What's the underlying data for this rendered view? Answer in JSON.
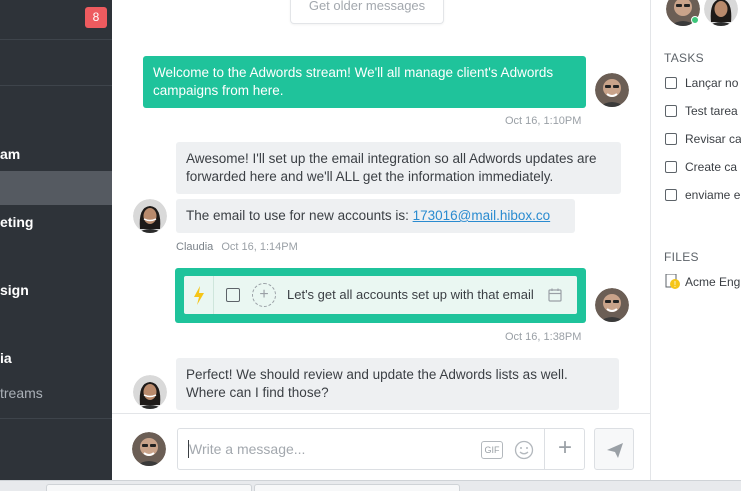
{
  "sidebar": {
    "badge": "8",
    "items": [
      {
        "label": "am"
      },
      {
        "label": ""
      },
      {
        "label": "eting"
      },
      {
        "label": "sign"
      },
      {
        "label": "ia"
      }
    ],
    "sub_label": "treams"
  },
  "chat": {
    "older_button": "Get older messages",
    "messages": [
      {
        "text": "Welcome to the Adwords stream! We'll all manage client's Adwords campaigns from here.",
        "time": "Oct 16, 1:10PM"
      },
      {
        "text": "Awesome! I'll set up the email integration so all Adwords updates are forwarded here and we'll ALL get the information immediately."
      },
      {
        "text_prefix": "The email to use for new accounts is: ",
        "link": "173016@mail.hibox.co",
        "author": "Claudia",
        "time": "Oct 16, 1:14PM"
      },
      {
        "task": "Let's get all accounts set up with that email",
        "time": "Oct 16, 1:38PM"
      },
      {
        "text": "Perfect! We should review and update the Adwords lists as well. Where can I find those?"
      }
    ],
    "composer": {
      "placeholder": "Write a message...",
      "gif_label": "GIF",
      "plus_label": "+"
    }
  },
  "right_panel": {
    "tasks_title": "TASKS",
    "tasks": [
      "Lançar no",
      "Test tarea",
      "Revisar ca",
      "Create ca",
      "enviame e"
    ],
    "files_title": "FILES",
    "files": [
      "Acme Eng"
    ]
  },
  "colors": {
    "accent": "#1fc39b",
    "sidebar_bg": "#2e3339",
    "badge": "#ee5b5f",
    "link": "#2a8bd0"
  }
}
